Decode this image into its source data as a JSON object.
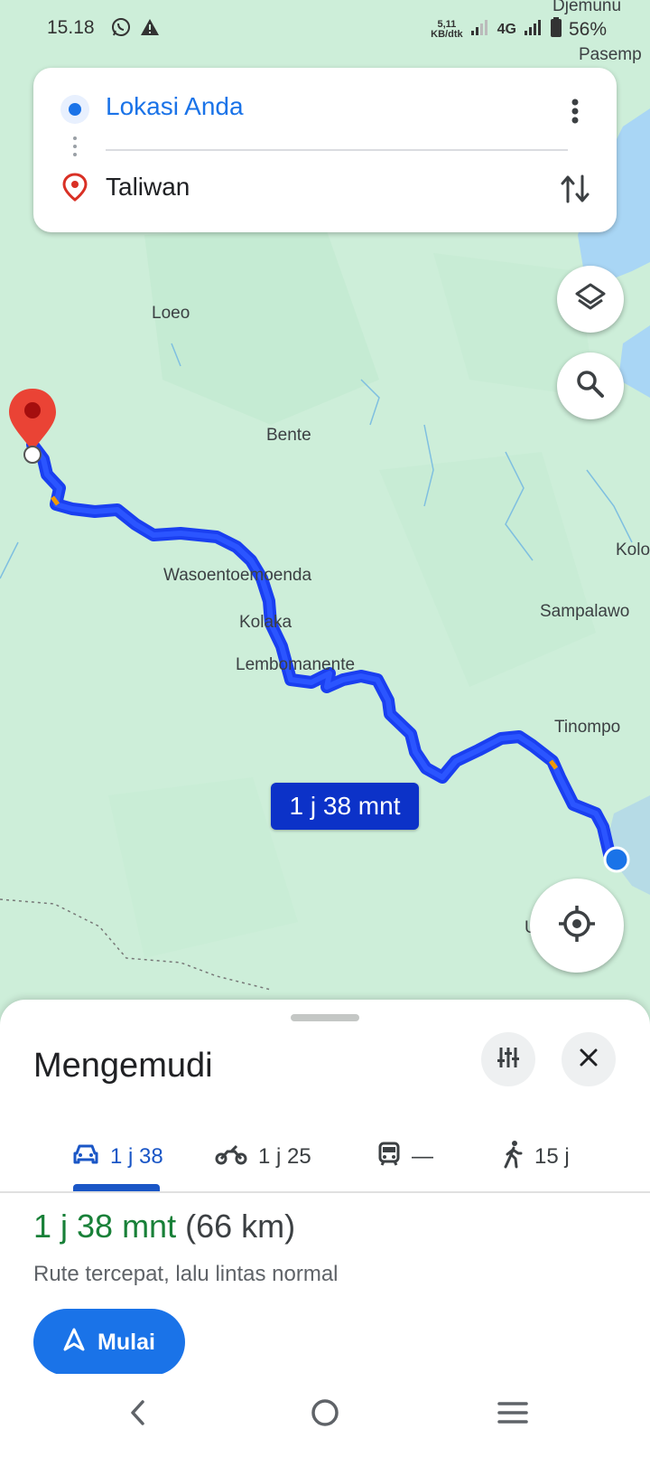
{
  "status_bar": {
    "time": "15.18",
    "speed_value": "5,11",
    "speed_unit": "KB/dtk",
    "network": "4G",
    "battery": "56%"
  },
  "directions": {
    "origin": "Lokasi Anda",
    "destination": "Taliwan"
  },
  "map": {
    "labels": {
      "djemunu": "Djemunu",
      "pasemp": "Pasemp",
      "loeo": "Loeo",
      "bente": "Bente",
      "kolo": "Kolo",
      "wasoentoemoenda": "Wasoentoemoenda",
      "sampalawo": "Sampalawo",
      "kolaka": "Kolaka",
      "lembomanente": "Lembomanente",
      "tinompo": "Tinompo",
      "u": "U"
    },
    "route_time_chip": "1 j 38 mnt",
    "colors": {
      "route": "#1a3ff0",
      "water": "#a9d6f5",
      "land": "#cdeed9"
    }
  },
  "sheet": {
    "title": "Mengemudi",
    "tabs": [
      {
        "icon": "car-icon",
        "label": "1 j 38"
      },
      {
        "icon": "motorcycle-icon",
        "label": "1 j 25"
      },
      {
        "icon": "transit-icon",
        "label": "—"
      },
      {
        "icon": "walk-icon",
        "label": "15 j"
      }
    ],
    "eta": "1 j 38 mnt",
    "distance": "(66 km)",
    "subtext": "Rute tercepat, lalu lintas normal",
    "start_label": "Mulai"
  }
}
